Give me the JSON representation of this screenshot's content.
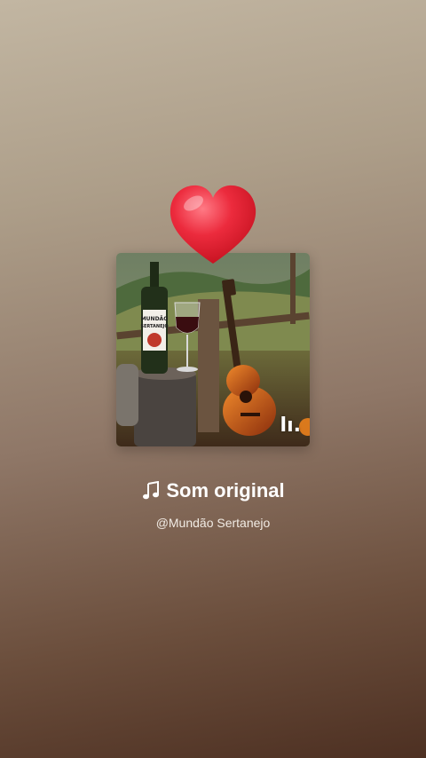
{
  "audio": {
    "title": "Som original",
    "author": "@Mundão Sertanejo"
  },
  "cover": {
    "bottle_label_line1": "MUNDÃO",
    "bottle_label_line2": "SERTANEJO",
    "badge_text": "lı."
  },
  "icons": {
    "heart": "heart-icon",
    "note": "music-note-icon"
  },
  "colors": {
    "heart": "#e8253a",
    "text": "#ffffff"
  }
}
